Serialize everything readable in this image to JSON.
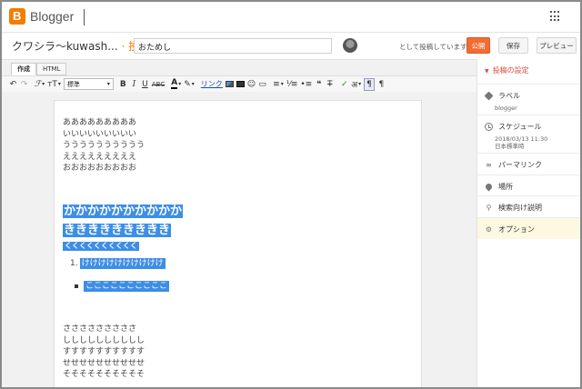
{
  "topbar": {
    "brand": "Blogger"
  },
  "title_row": {
    "blog_name": "クワシラ〜kuwash...",
    "separator": "·",
    "post_label": "投稿",
    "title_value": "おためし",
    "posting_as": "として投稿しています",
    "publish_label": "公開",
    "save_label": "保存",
    "preview_label": "プレビュー"
  },
  "editor": {
    "tabs": [
      "作成",
      "HTML"
    ],
    "font_select": "標準",
    "link_label": "リンク",
    "lines_normal_1": [
      "あああああああああ",
      "いいいいいいいいい",
      "うううううううううう",
      "えええええええええ",
      "おおおおおおおおお"
    ],
    "big_line_1": "かかかかかかかかかか",
    "big_line_2": "ききききききききき",
    "small_line": "くくくくくくくくくく",
    "ordered_num": "1.",
    "ordered_item": "けけけけけけけけけけ",
    "bullet_item": "ここここここここここ",
    "lines_normal_2": [
      "さささささささささ",
      "しししししししししし",
      "すすすすすすすすすす",
      "せせせせせせせせせせ",
      "そそそそそそそそそそ"
    ]
  },
  "sidebar": {
    "section_title": "投稿の設定",
    "labels_title": "ラベル",
    "labels_value": "blogger",
    "schedule_title": "スケジュール",
    "schedule_date": "2018/03/13 11:30",
    "schedule_tz": "日本標準時",
    "permalink_title": "パーマリンク",
    "location_title": "場所",
    "search_desc_title": "検索向け説明",
    "options_title": "オプション"
  }
}
